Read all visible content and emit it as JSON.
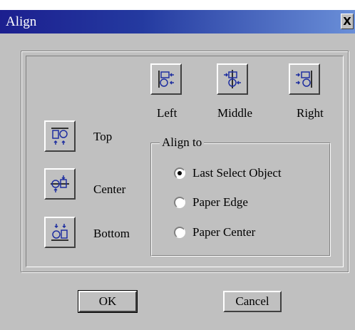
{
  "window": {
    "title": "Align",
    "close_glyph": "X"
  },
  "horizontal": {
    "left": {
      "label": "Left",
      "icon": "align-left-icon"
    },
    "middle": {
      "label": "Middle",
      "icon": "align-middle-icon"
    },
    "right": {
      "label": "Right",
      "icon": "align-right-icon"
    }
  },
  "vertical": {
    "top": {
      "label": "Top",
      "icon": "align-top-icon"
    },
    "center": {
      "label": "Center",
      "icon": "align-center-icon"
    },
    "bottom": {
      "label": "Bottom",
      "icon": "align-bottom-icon"
    }
  },
  "align_to": {
    "legend": "Align to",
    "options": [
      {
        "label": "Last Select Object",
        "selected": true
      },
      {
        "label": "Paper Edge",
        "selected": false
      },
      {
        "label": "Paper Center",
        "selected": false
      }
    ]
  },
  "buttons": {
    "ok": "OK",
    "cancel": "Cancel"
  },
  "colors": {
    "face": "#c0c0c0",
    "title_start": "#1c1f8f",
    "title_end": "#6a8fd8",
    "icon_blue": "#1f2fa0"
  }
}
